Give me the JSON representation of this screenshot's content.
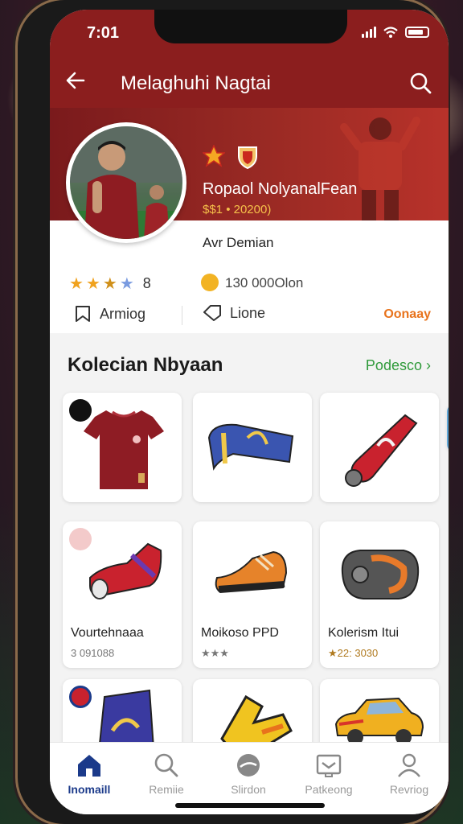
{
  "status_bar": {
    "time": "7:01"
  },
  "app_bar": {
    "title": "Melaghuhi Nagtai"
  },
  "profile": {
    "player_name": "Ropaol Nolyanal‌Fean",
    "player_value": "$$1 • 20200)",
    "member_label": "Avr Demian",
    "rating_number": "8",
    "stars_filled": 3,
    "stars_total": 4,
    "coins": "130 000Olon",
    "actions": {
      "first": "Armiog",
      "second": "Lione",
      "third": "Oonaay"
    }
  },
  "section": {
    "title": "Kolecian Nbyaan",
    "link": "Podesco"
  },
  "collection": [
    {
      "name": "",
      "meta": "",
      "icon": "jersey-icon"
    },
    {
      "name": "",
      "meta": "",
      "icon": "scarf-icon"
    },
    {
      "name": "",
      "meta": "",
      "icon": "shin-guard-icon"
    },
    {
      "name": "Vourtehnaaa",
      "meta": "3 091088",
      "icon": "boot-icon"
    },
    {
      "name": "Moikoso PPD",
      "meta": "★★★",
      "icon": "shoe-icon"
    },
    {
      "name": "Kolerism Itui",
      "meta": "★22: 3030",
      "icon": "glove-icon"
    },
    {
      "name": "",
      "meta": "",
      "icon": "flag-icon"
    },
    {
      "name": "",
      "meta": "",
      "icon": "bolt-icon"
    },
    {
      "name": "",
      "meta": "",
      "icon": "car-icon"
    }
  ],
  "bottom_nav": [
    {
      "label": "Inomaill",
      "icon": "home-icon",
      "active": true
    },
    {
      "label": "Remiie",
      "icon": "search-icon",
      "active": false
    },
    {
      "label": "Slirdon",
      "icon": "ball-icon",
      "active": false
    },
    {
      "label": "Patkeong",
      "icon": "inbox-icon",
      "active": false
    },
    {
      "label": "Revriog",
      "icon": "profile-icon",
      "active": false
    }
  ],
  "colors": {
    "brand": "#8b1e1e",
    "accent_green": "#2f9a3a",
    "accent_orange": "#e8731c",
    "nav_active": "#1b3a8a"
  }
}
